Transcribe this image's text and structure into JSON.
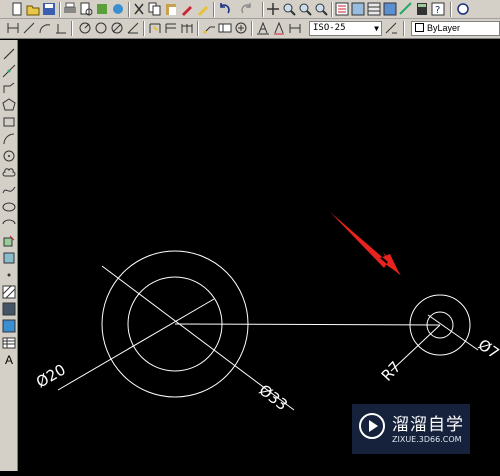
{
  "toolbar_top": {
    "icons": [
      "new-icon",
      "open-icon",
      "save-icon",
      "print-icon",
      "preview-icon",
      "publish-icon",
      "plot-icon",
      "cut-icon",
      "copy-icon",
      "paste-icon",
      "brush-icon",
      "match-icon",
      "undo-icon",
      "redo-icon",
      "pan-icon",
      "zoom-realtime-icon",
      "zoom-window-icon",
      "zoom-previous-icon",
      "properties-icon",
      "design-center-icon",
      "tool-palette-icon",
      "sheet-set-icon",
      "markup-icon",
      "calculator-icon",
      "help-icon",
      "extra-icon"
    ]
  },
  "toolbar_dim": {
    "icons": [
      "linear-dim-icon",
      "aligned-dim-icon",
      "arc-length-icon",
      "ordinate-icon",
      "radius-icon",
      "jogged-icon",
      "diameter-icon",
      "angular-icon",
      "quick-dim-icon",
      "baseline-icon",
      "continue-icon",
      "qleader-icon",
      "tolerance-icon",
      "center-mark-icon",
      "dimedit-icon",
      "dimtedit-icon",
      "update-icon"
    ],
    "dimstyle_value": "ISO-25",
    "layer_value": "ByLayer"
  },
  "draw_tools": {
    "icons": [
      "line-icon",
      "construction-line-icon",
      "polyline-icon",
      "polygon-icon",
      "rectangle-icon",
      "arc-icon",
      "circle-icon",
      "revision-cloud-icon",
      "spline-icon",
      "ellipse-icon",
      "ellipse-arc-icon",
      "insert-block-icon",
      "make-block-icon",
      "point-icon",
      "hatch-icon",
      "gradient-icon",
      "region-icon",
      "table-icon",
      "mtext-icon"
    ],
    "mtext_label": "A"
  },
  "drawing": {
    "labels": {
      "dia20": "Ø20",
      "dia33": "Ø33",
      "r7": "R7",
      "dia7": "Ø7"
    },
    "line_color": "#ffffff",
    "arrow_color": "#e8231f"
  },
  "watermark": {
    "brand": "溜溜自学",
    "url": "ZIXUE.3D66.COM"
  }
}
